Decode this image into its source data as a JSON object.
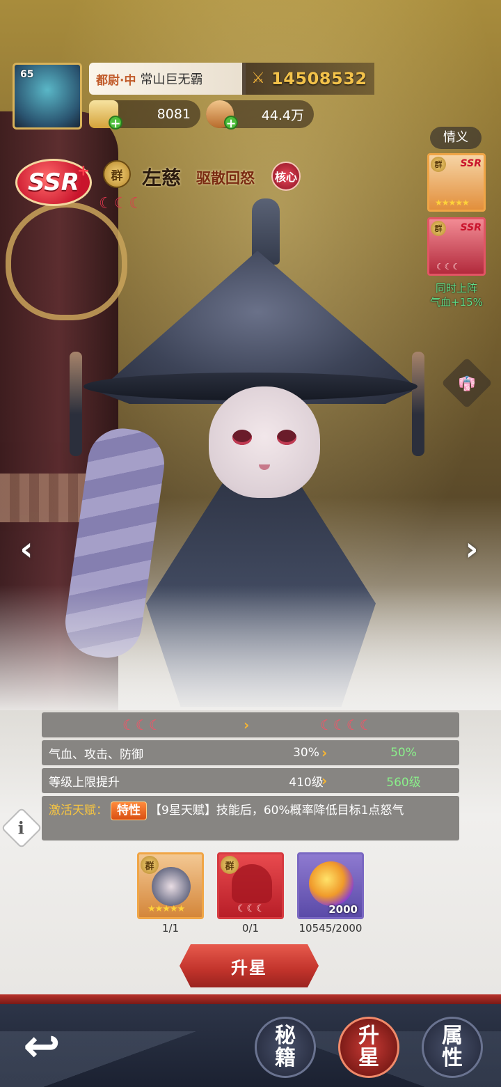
{
  "player": {
    "level": "65",
    "rank": "都尉·中",
    "name": "常山巨无霸",
    "power": "14508532"
  },
  "resources": {
    "gold": "8081",
    "coins": "44.4万"
  },
  "hero": {
    "rarity": "SSR",
    "rarity_plus": "+",
    "faction": "群",
    "name": "左慈",
    "skill": "驱散回怒",
    "core": "核心",
    "moons": "☾☾☾"
  },
  "bond": {
    "label": "情义",
    "cards": [
      {
        "faction": "群",
        "rarity": "SSR",
        "stars": "★★★★★"
      },
      {
        "faction": "群",
        "rarity": "SSR",
        "moons": "☾☾☾"
      }
    ],
    "bonus_line1": "同时上阵",
    "bonus_line2": "气血+15%"
  },
  "stats": {
    "star_from": "☾☾☾",
    "star_to": "☾☾☾☾",
    "rows": [
      {
        "label": "气血、攻击、防御",
        "from": "30%",
        "to": "50%"
      },
      {
        "label": "等级上限提升",
        "from": "410级",
        "to": "560级"
      }
    ],
    "talent_label": "激活天赋：",
    "talent_tag": "特性",
    "talent_text": "【9星天赋】技能后，60%概率降低目标1点怒气"
  },
  "materials": [
    {
      "faction": "群",
      "stars": "★★★★★",
      "count": "1/1"
    },
    {
      "faction": "群",
      "moons": "☾☾☾",
      "count": "0/1"
    },
    {
      "amount": "2000",
      "count": "10545/2000"
    }
  ],
  "upgrade_button": "升星",
  "tabs": [
    {
      "line1": "秘",
      "line2": "籍"
    },
    {
      "line1": "升",
      "line2": "星"
    },
    {
      "line1": "属",
      "line2": "性"
    }
  ],
  "arrow_glyph": "›",
  "icons": {
    "back": "back-arrow-icon",
    "info": "i"
  }
}
